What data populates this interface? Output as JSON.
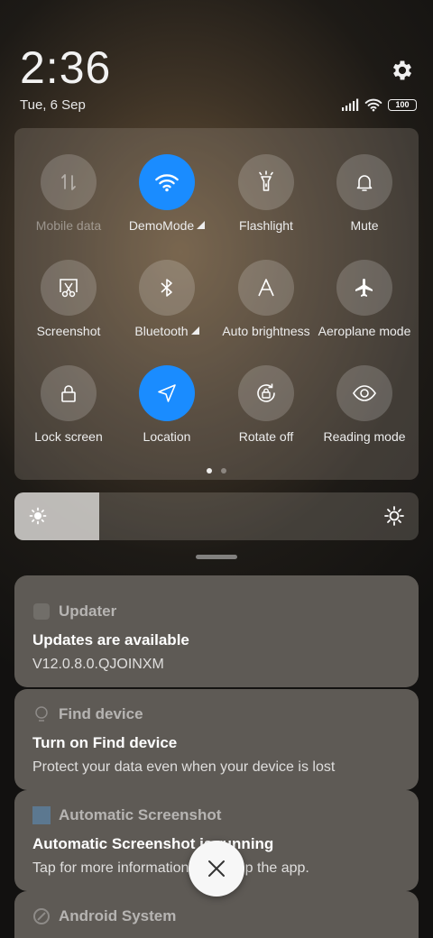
{
  "status": {
    "time": "2:36",
    "date": "Tue, 6 Sep",
    "battery": "100",
    "icons": [
      "signal-icon",
      "wifi-icon",
      "battery-icon",
      "settings-icon"
    ]
  },
  "tiles": [
    {
      "label": "Mobile data",
      "icon": "mobile-data-icon",
      "state": "unavailable"
    },
    {
      "label": "DemoMode",
      "icon": "wifi-icon",
      "state": "active",
      "expandable": true
    },
    {
      "label": "Flashlight",
      "icon": "flashlight-icon",
      "state": "off"
    },
    {
      "label": "Mute",
      "icon": "bell-icon",
      "state": "off"
    },
    {
      "label": "Screenshot",
      "icon": "screenshot-icon",
      "state": "off"
    },
    {
      "label": "Bluetooth",
      "icon": "bluetooth-icon",
      "state": "off",
      "expandable": true
    },
    {
      "label": "Auto brightness",
      "icon": "auto-brightness-icon",
      "state": "off"
    },
    {
      "label": "Aeroplane mode",
      "icon": "airplane-icon",
      "state": "off"
    },
    {
      "label": "Lock screen",
      "icon": "lock-icon",
      "state": "off"
    },
    {
      "label": "Location",
      "icon": "location-icon",
      "state": "active"
    },
    {
      "label": "Rotate off",
      "icon": "rotate-lock-icon",
      "state": "off"
    },
    {
      "label": "Reading mode",
      "icon": "eye-icon",
      "state": "off"
    }
  ],
  "pager": {
    "pages": 2,
    "current": 1
  },
  "brightness": {
    "level": 0.21
  },
  "notifications": [
    {
      "app": "Updater",
      "title": "Updates are available",
      "body": "V12.0.8.0.QJOINXM",
      "icon": "updater-icon"
    },
    {
      "app": "Find device",
      "title": "Turn on Find device",
      "body": "Protect your data even when your device is lost",
      "icon": "find-device-icon"
    },
    {
      "app": "Automatic Screenshot",
      "title": "Automatic Screenshot is running",
      "body": "Tap for more information or to stop the app.",
      "icon": "screenshot-app-icon"
    },
    {
      "app": "Android System",
      "title": "",
      "body": "",
      "icon": "android-system-icon"
    }
  ],
  "colors": {
    "accent": "#1a8cff",
    "card": "#5e5a55",
    "fab": "#f7f7f7"
  }
}
